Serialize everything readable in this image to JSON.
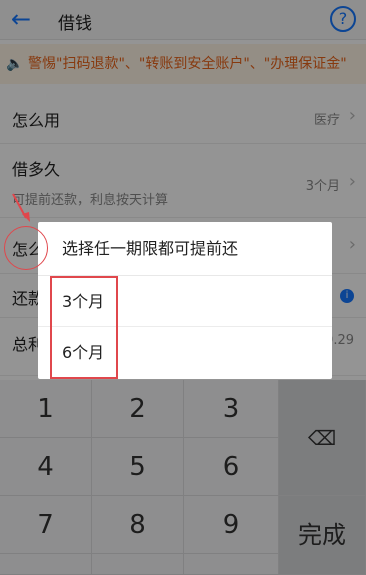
{
  "header": {
    "back_icon": "back-arrow-icon",
    "title": "借钱",
    "help_label": "?"
  },
  "banner": {
    "icon": "speaker-icon",
    "text": "警惕\"扫码退款\"、\"转账到安全账户\"、\"办理保证金\""
  },
  "form": {
    "usage": {
      "label": "怎么用",
      "value": "医疗"
    },
    "duration": {
      "label": "借多久",
      "sub": "可提前还款，利息按天计算",
      "value": "3个月"
    },
    "repay_method": {
      "label": "怎么"
    },
    "repay": {
      "label": "还款"
    },
    "total": {
      "label": "总利",
      "value": "0.29"
    }
  },
  "dialog": {
    "title": "选择任一期限都可提前还",
    "options": [
      "3个月",
      "6个月"
    ]
  },
  "keyboard": {
    "keys": [
      "1",
      "2",
      "3",
      "4",
      "5",
      "6",
      "7",
      "8",
      "9"
    ],
    "done_label": "完成",
    "delete_icon": "backspace-icon"
  },
  "colors": {
    "accent": "#1677ff",
    "warning": "#e8641b",
    "highlight": "#e0474c"
  }
}
